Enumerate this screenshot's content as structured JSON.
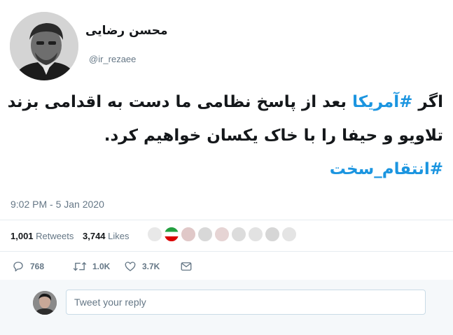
{
  "author": {
    "display_name": "محسن رضایی",
    "handle": "@ir_rezaee"
  },
  "tweet": {
    "line1_prefix": "اگر ",
    "line1_hashtag": "#آمریکا",
    "line1_suffix": " بعد از پاسخ نظامی ما دست به اقدامی بزند",
    "line2": "تلاویو و حیفا را با خاک یکسان خواهیم کرد.",
    "line3_hashtag": "#انتقام_سخت",
    "timestamp": "9:02 PM - 5 Jan 2020"
  },
  "stats": {
    "retweets_count": "1,001",
    "retweets_label": "Retweets",
    "likes_count": "3,744",
    "likes_label": "Likes"
  },
  "actions": {
    "reply_count": "768",
    "retweet_count": "1.0K",
    "like_count": "3.7K"
  },
  "reply": {
    "placeholder": "Tweet your reply"
  },
  "colors": {
    "hashtag": "#1b95e0",
    "secondary_text": "#657786",
    "primary_text": "#14171a"
  }
}
